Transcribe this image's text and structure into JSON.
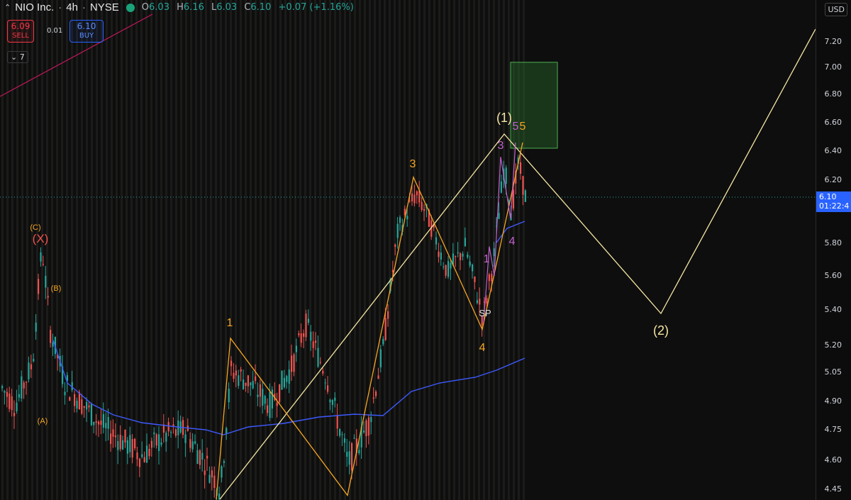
{
  "header": {
    "symbol": "NIO Inc.",
    "interval": "4h",
    "exchange": "NYSE",
    "ohlc": {
      "o_label": "O",
      "o": "6.03",
      "h_label": "H",
      "h": "6.16",
      "l_label": "L",
      "l": "6.03",
      "c_label": "C",
      "c": "6.10",
      "change": "+0.07 (+1.16%)"
    }
  },
  "trade": {
    "sell_price": "6.09",
    "sell_label": "SELL",
    "spread": "0.01",
    "buy_price": "6.10",
    "buy_label": "BUY"
  },
  "indicators_toggle": "7",
  "axis": {
    "unit": "USD",
    "current_price": "6.10",
    "countdown": "01:22:4"
  },
  "colors": {
    "background": "#0e0e0e",
    "up": "#26a69a",
    "down": "#ef5350",
    "ma": "#3d5afe",
    "wave_yellow": "#f5e6a3",
    "wave_orange": "#f5a623",
    "wave_purple": "#c061cb",
    "target_box": "#2e7d32",
    "trendline": "#c2185b"
  },
  "chart_data": {
    "type": "candlestick",
    "price_scale": {
      "min": 4.45,
      "max": 7.2,
      "ticks": [
        "7.20",
        "7.00",
        "6.80",
        "6.60",
        "6.40",
        "6.20",
        "5.80",
        "5.60",
        "5.40",
        "5.20",
        "5.05",
        "4.90",
        "4.75",
        "4.60",
        "4.45"
      ]
    },
    "last_price": 6.1,
    "annotations": [
      {
        "text": "(C)",
        "color": "orange"
      },
      {
        "text": "(X)",
        "color": "red"
      },
      {
        "text": "(B)",
        "color": "orange"
      },
      {
        "text": "(A)",
        "color": "orange"
      },
      {
        "text": "1",
        "color": "orange"
      },
      {
        "text": "3",
        "color": "orange"
      },
      {
        "text": "4",
        "color": "orange"
      },
      {
        "text": "5",
        "color": "orange"
      },
      {
        "text": "(1)",
        "color": "yellow"
      },
      {
        "text": "(2)",
        "color": "yellow"
      },
      {
        "text": "1",
        "color": "purple"
      },
      {
        "text": "3",
        "color": "purple"
      },
      {
        "text": "4",
        "color": "purple"
      },
      {
        "text": "5",
        "color": "purple"
      },
      {
        "text": "SP",
        "color": "white"
      }
    ],
    "yellow_wave": [
      {
        "label": "start",
        "price": 4.4
      },
      {
        "label": "(1)",
        "price": 6.52
      },
      {
        "label": "(2)",
        "price": 5.38
      },
      {
        "label": "end",
        "price": 7.3
      }
    ],
    "orange_wave": [
      {
        "label": "",
        "price": 4.4
      },
      {
        "label": "1",
        "price": 5.24
      },
      {
        "label": "2",
        "price": 4.42
      },
      {
        "label": "3",
        "price": 6.22
      },
      {
        "label": "4",
        "price": 5.29
      },
      {
        "label": "5",
        "price": 6.46
      }
    ],
    "purple_wave": [
      {
        "label": "",
        "price": 5.33
      },
      {
        "label": "1",
        "price": 5.78
      },
      {
        "label": "",
        "price": 5.6
      },
      {
        "label": "3",
        "price": 6.36
      },
      {
        "label": "4",
        "price": 5.96
      },
      {
        "label": "5",
        "price": 6.46
      }
    ],
    "target_box": {
      "price_top": 7.04,
      "price_bottom": 6.42
    }
  }
}
